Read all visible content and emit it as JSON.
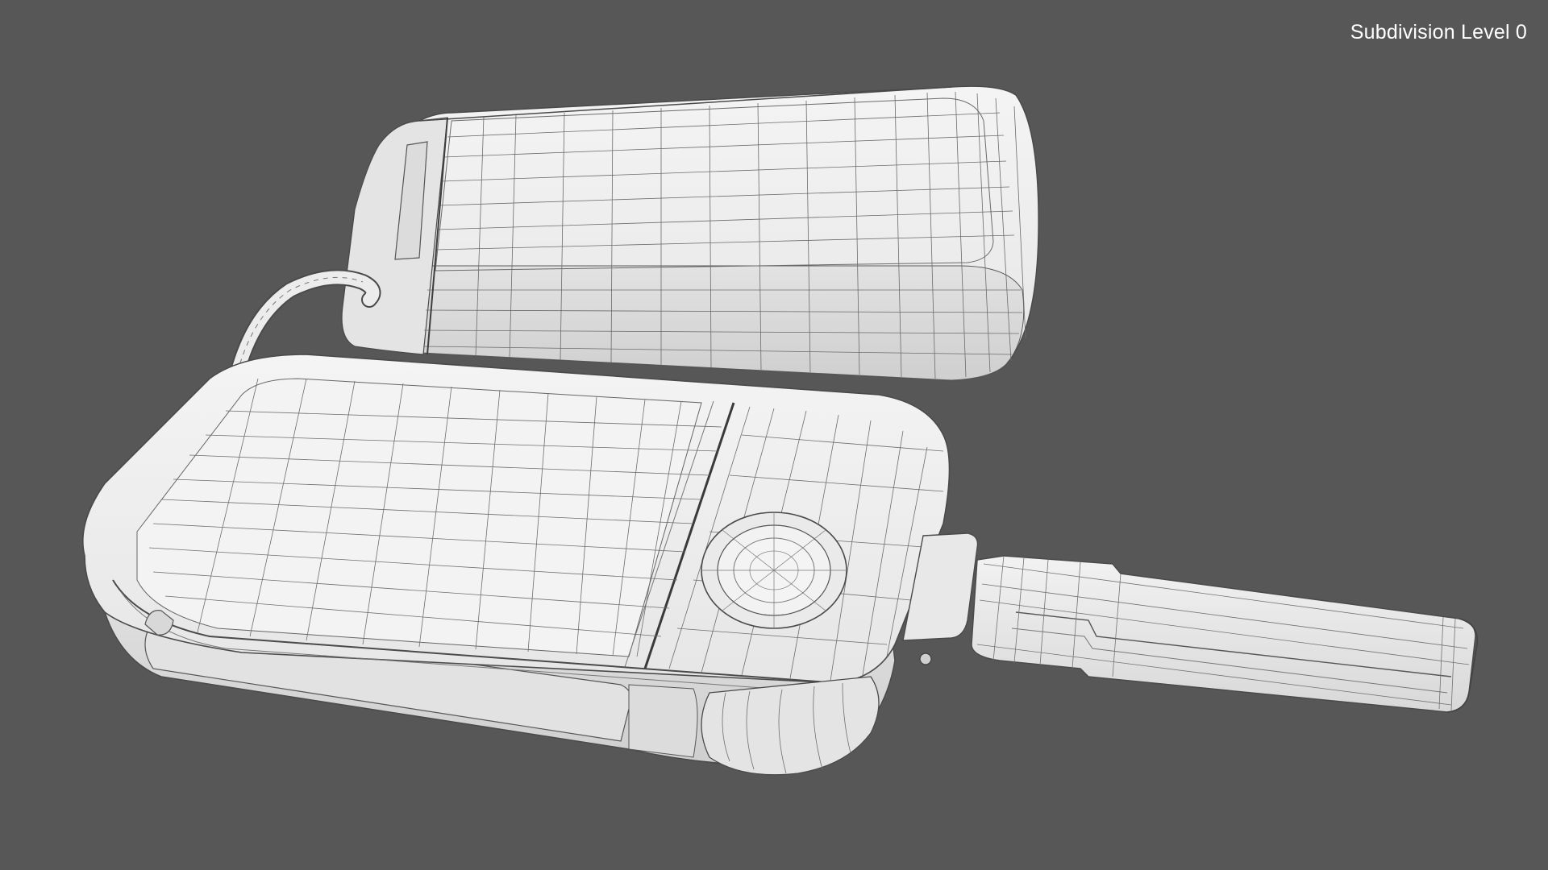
{
  "viewport": {
    "overlay_label": "Subdivision Level 0",
    "background_color": "#575757",
    "model_color": "#eeeeee",
    "wire_color": "#5a5a5a"
  },
  "scene": {
    "objects": [
      "car-key-fob-back",
      "car-key-fob-front",
      "key-ring",
      "flip-key-blade",
      "unlock-button"
    ],
    "render_mode": "wireframe-on-shaded"
  }
}
